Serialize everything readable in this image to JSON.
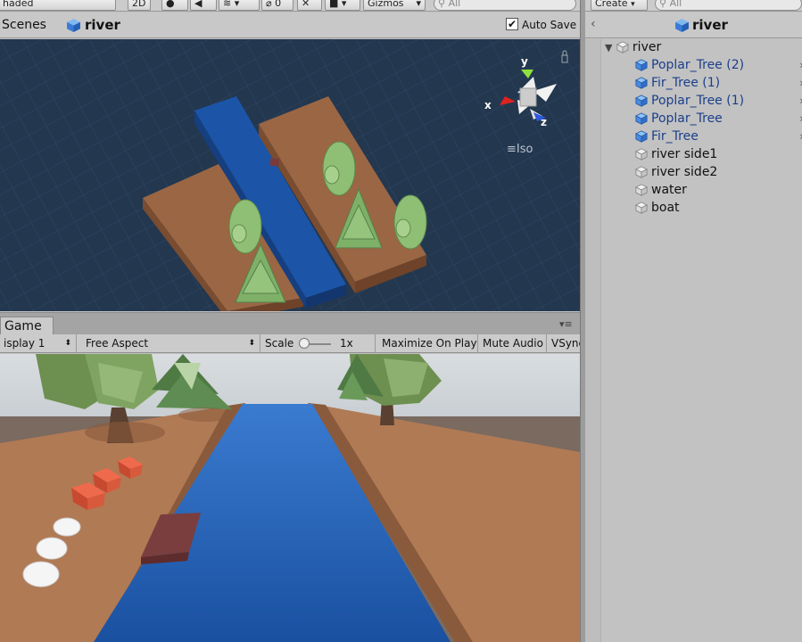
{
  "scene_toolbar": {
    "shading_mode": "haded",
    "mode_2d": "2D",
    "hidden_count": "0",
    "gizmos_label": "Gizmos",
    "search_placeholder": "All"
  },
  "scene_titlebar": {
    "scenes_label": "Scenes",
    "scene_name": "river",
    "auto_save_label": "Auto Save",
    "auto_save_checked": true
  },
  "scene_gizmo": {
    "y_label": "y",
    "x_label": "x",
    "z_label": "z",
    "projection_label": "Iso"
  },
  "game_panel": {
    "tab_label": "Game",
    "display_label": "isplay 1",
    "aspect_label": "Free Aspect",
    "scale_label": "Scale",
    "scale_value": "1x",
    "maximize_label": "Maximize On Play",
    "mute_label": "Mute Audio",
    "vsync_label": "VSync"
  },
  "hierarchy": {
    "create_label": "Create",
    "search_placeholder": "All",
    "scene_name": "river",
    "root": "river",
    "items": [
      {
        "label": "Poplar_Tree (2)",
        "prefab": true
      },
      {
        "label": "Fir_Tree (1)",
        "prefab": true
      },
      {
        "label": "Poplar_Tree (1)",
        "prefab": true
      },
      {
        "label": "Poplar_Tree",
        "prefab": true
      },
      {
        "label": "Fir_Tree",
        "prefab": true
      },
      {
        "label": "river side1",
        "prefab": false
      },
      {
        "label": "river side2",
        "prefab": false
      },
      {
        "label": "water",
        "prefab": false
      },
      {
        "label": "boat",
        "prefab": false
      }
    ]
  },
  "colors": {
    "scene_bg": "#23374f",
    "ground": "#9a6644",
    "water": "#1c55a8",
    "prefab_text": "#1b3f8a"
  }
}
